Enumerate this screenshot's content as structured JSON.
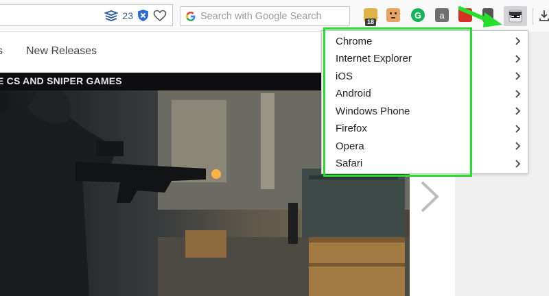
{
  "toolbar": {
    "count": "23",
    "search_placeholder": "Search with Google Search",
    "ext_badge": "18"
  },
  "page": {
    "nav_fragment": "s",
    "nav_item": "New Releases",
    "hero_caption": "E CS AND SNIPER GAMES"
  },
  "menu": {
    "items": [
      {
        "label": "Chrome"
      },
      {
        "label": "Internet Explorer"
      },
      {
        "label": "iOS"
      },
      {
        "label": "Android"
      },
      {
        "label": "Windows Phone"
      },
      {
        "label": "Firefox"
      },
      {
        "label": "Opera"
      },
      {
        "label": "Safari"
      }
    ]
  },
  "colors": {
    "highlight": "#24e02c",
    "accent_blue": "#2b6cd8"
  }
}
